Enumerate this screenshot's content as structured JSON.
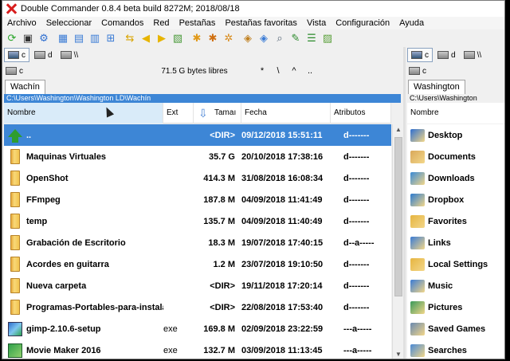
{
  "window": {
    "title": "Double Commander 0.8.4 beta build 8272M; 2018/08/18"
  },
  "menu": [
    "Archivo",
    "Seleccionar",
    "Comandos",
    "Red",
    "Pestañas",
    "Pestañas favoritas",
    "Vista",
    "Configuración",
    "Ayuda"
  ],
  "toolbar": {
    "buttons": [
      {
        "name": "refresh-icon",
        "glyph": "⟳",
        "color": "#2aa52a"
      },
      {
        "name": "terminal-icon",
        "glyph": "▣",
        "color": "#333333"
      },
      {
        "name": "options-icon",
        "glyph": "⚙",
        "color": "#2f6fd0"
      },
      {
        "name": "brief-view-icon",
        "glyph": "▦",
        "color": "#3a7bd5"
      },
      {
        "name": "full-view-icon",
        "glyph": "▤",
        "color": "#3a7bd5"
      },
      {
        "name": "thumbnails-icon",
        "glyph": "▥",
        "color": "#3a7bd5"
      },
      {
        "name": "tree-view-icon",
        "glyph": "⊞",
        "color": "#3a7bd5"
      },
      {
        "name": "sync-dirs-icon",
        "glyph": "⇆",
        "color": "#d9a400"
      },
      {
        "name": "copy-left-icon",
        "glyph": "◀",
        "color": "#e7b400"
      },
      {
        "name": "copy-right-icon",
        "glyph": "▶",
        "color": "#e7b400"
      },
      {
        "name": "compare-icon",
        "glyph": "▧",
        "color": "#4a9a3a"
      },
      {
        "name": "select-group-icon",
        "glyph": "✱",
        "color": "#e19a1a"
      },
      {
        "name": "unselect-group-icon",
        "glyph": "✱",
        "color": "#d07010"
      },
      {
        "name": "invert-selection-icon",
        "glyph": "✲",
        "color": "#d88a1a"
      },
      {
        "name": "pack-icon",
        "glyph": "◈",
        "color": "#c08020"
      },
      {
        "name": "unpack-icon",
        "glyph": "◈",
        "color": "#3a7bd5"
      },
      {
        "name": "search-icon",
        "glyph": "⌕",
        "color": "#556677"
      },
      {
        "name": "rename-icon",
        "glyph": "✎",
        "color": "#2a8a2a"
      },
      {
        "name": "multi-rename-icon",
        "glyph": "☰",
        "color": "#2a8a2a"
      },
      {
        "name": "edit-icon",
        "glyph": "▨",
        "color": "#5aa03a"
      }
    ]
  },
  "left": {
    "drives": [
      {
        "label": "c",
        "active": true
      },
      {
        "label": "d",
        "active": false
      },
      {
        "label": "\\\\",
        "active": false
      }
    ],
    "pathrow": {
      "drive": "c",
      "free": "71.5 G bytes libres",
      "nav": [
        "*",
        "\\",
        "^",
        ".."
      ]
    },
    "tab": "Wachín",
    "path": "C:\\Users\\Washington\\Washington LD\\Wachín",
    "columns": {
      "name": "Nombre",
      "ext": "Ext",
      "size": "Tamaı",
      "date": "Fecha",
      "attr": "Atributos"
    },
    "files": [
      {
        "icon": "up",
        "name": "..",
        "ext": "",
        "size": "<DIR>",
        "date": "09/12/2018 15:51:11",
        "attr": "d-------",
        "selected": true
      },
      {
        "icon": "folder",
        "name": "Maquinas Virtuales",
        "ext": "",
        "size": "35.7 G",
        "date": "20/10/2018 17:38:16",
        "attr": "d-------"
      },
      {
        "icon": "folder",
        "name": "OpenShot",
        "ext": "",
        "size": "414.3 M",
        "date": "31/08/2018 16:08:34",
        "attr": "d-------"
      },
      {
        "icon": "folder",
        "name": "FFmpeg",
        "ext": "",
        "size": "187.8 M",
        "date": "04/09/2018 11:41:49",
        "attr": "d-------"
      },
      {
        "icon": "folder",
        "name": "temp",
        "ext": "",
        "size": "135.7 M",
        "date": "04/09/2018 11:40:49",
        "attr": "d-------"
      },
      {
        "icon": "folder",
        "name": "Grabación de Escritorio",
        "ext": "",
        "size": "18.3 M",
        "date": "19/07/2018 17:40:15",
        "attr": "d--a-----"
      },
      {
        "icon": "folder",
        "name": "Acordes en guitarra",
        "ext": "",
        "size": "1.2 M",
        "date": "23/07/2018 19:10:50",
        "attr": "d-------"
      },
      {
        "icon": "folder",
        "name": "Nueva carpeta",
        "ext": "",
        "size": "<DIR>",
        "date": "19/11/2018 17:20:14",
        "attr": "d-------"
      },
      {
        "icon": "folder",
        "name": "Programas-Portables-para-instalar",
        "ext": "",
        "size": "<DIR>",
        "date": "22/08/2018 17:53:40",
        "attr": "d-------"
      },
      {
        "icon": "exe",
        "name": "gimp-2.10.6-setup",
        "ext": "exe",
        "size": "169.8 M",
        "date": "02/09/2018 23:22:59",
        "attr": "---a-----"
      },
      {
        "icon": "mm",
        "name": "Movie Maker 2016",
        "ext": "exe",
        "size": "132.7 M",
        "date": "03/09/2018 11:13:45",
        "attr": "---a-----"
      }
    ]
  },
  "right": {
    "drives": [
      {
        "label": "c",
        "active": true
      },
      {
        "label": "d",
        "active": false
      },
      {
        "label": "\\\\",
        "active": false
      }
    ],
    "pathrow": {
      "drive": "c"
    },
    "tab": "Washington",
    "path": "C:\\Users\\Washington",
    "columns": {
      "name": "Nombre"
    },
    "items": [
      {
        "name": "Desktop",
        "color": "#2f6fd0"
      },
      {
        "name": "Documents",
        "color": "#d9a85a"
      },
      {
        "name": "Downloads",
        "color": "#3a8ad6"
      },
      {
        "name": "Dropbox",
        "color": "#2c7bd0"
      },
      {
        "name": "Favorites",
        "color": "#e6b540"
      },
      {
        "name": "Links",
        "color": "#3a7bd5"
      },
      {
        "name": "Local Settings",
        "color": "#e6b540"
      },
      {
        "name": "Music",
        "color": "#3a7bd5"
      },
      {
        "name": "Pictures",
        "color": "#3a9a5a"
      },
      {
        "name": "Saved Games",
        "color": "#6a8ab0"
      },
      {
        "name": "Searches",
        "color": "#4a8ad6"
      }
    ]
  }
}
